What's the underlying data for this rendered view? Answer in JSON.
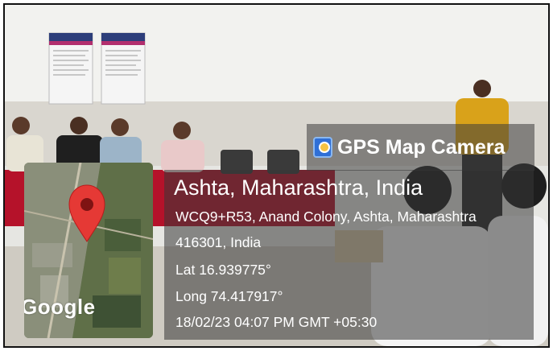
{
  "app_title": "GPS Map Camera",
  "location": {
    "place": "Ashta, Maharashtra, India",
    "address_line1": "WCQ9+R53, Anand Colony, Ashta, Maharashtra",
    "address_line2": "416301, India",
    "latitude": "Lat 16.939775°",
    "longitude": "Long 74.417917°",
    "datetime": "18/02/23 04:07 PM GMT +05:30"
  },
  "map": {
    "provider_logo": "Google",
    "marker_color": "#e53935"
  },
  "colors": {
    "overlay": "#373737",
    "badge_icon": "#2f6fd6",
    "text": "#ffffff"
  }
}
